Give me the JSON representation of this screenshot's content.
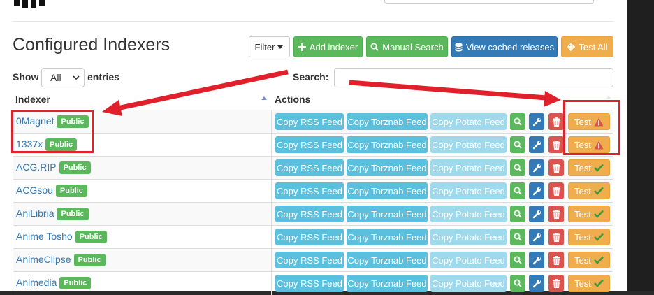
{
  "title": "Configured Indexers",
  "toolbar": {
    "filter": "Filter",
    "add_indexer": "Add indexer",
    "manual_search": "Manual Search",
    "view_cached": "View cached releases",
    "test_all": "Test All"
  },
  "length": {
    "show": "Show",
    "value": "All",
    "entries": "entries"
  },
  "search": {
    "label": "Search:",
    "value": ""
  },
  "columns": {
    "indexer": "Indexer",
    "actions": "Actions"
  },
  "row_actions": {
    "rss": "Copy RSS Feed",
    "torznab": "Copy Torznab Feed",
    "potato": "Copy Potato Feed",
    "test": "Test"
  },
  "indexers": [
    {
      "name": "0Magnet",
      "badge": "Public",
      "status": "error"
    },
    {
      "name": "1337x",
      "badge": "Public",
      "status": "error"
    },
    {
      "name": "ACG.RIP",
      "badge": "Public",
      "status": "ok"
    },
    {
      "name": "ACGsou",
      "badge": "Public",
      "status": "ok"
    },
    {
      "name": "AniLibria",
      "badge": "Public",
      "status": "ok"
    },
    {
      "name": "Anime Tosho",
      "badge": "Public",
      "status": "ok"
    },
    {
      "name": "AnimeClipse",
      "badge": "Public",
      "status": "ok"
    },
    {
      "name": "Animedia",
      "badge": "Public",
      "status": "ok"
    }
  ],
  "colors": {
    "success": "#5cb85c",
    "primary": "#337ab7",
    "info": "#5bc0de",
    "warning": "#f0ad4e",
    "danger": "#d9534f",
    "annotation": "#e0202a"
  },
  "icons": {
    "add": "plus-icon",
    "search": "search-icon",
    "cache": "database-icon",
    "test_all": "crosshair-icon",
    "config": "wrench-icon",
    "delete": "trash-icon",
    "error": "warning-icon",
    "ok": "check-icon"
  }
}
